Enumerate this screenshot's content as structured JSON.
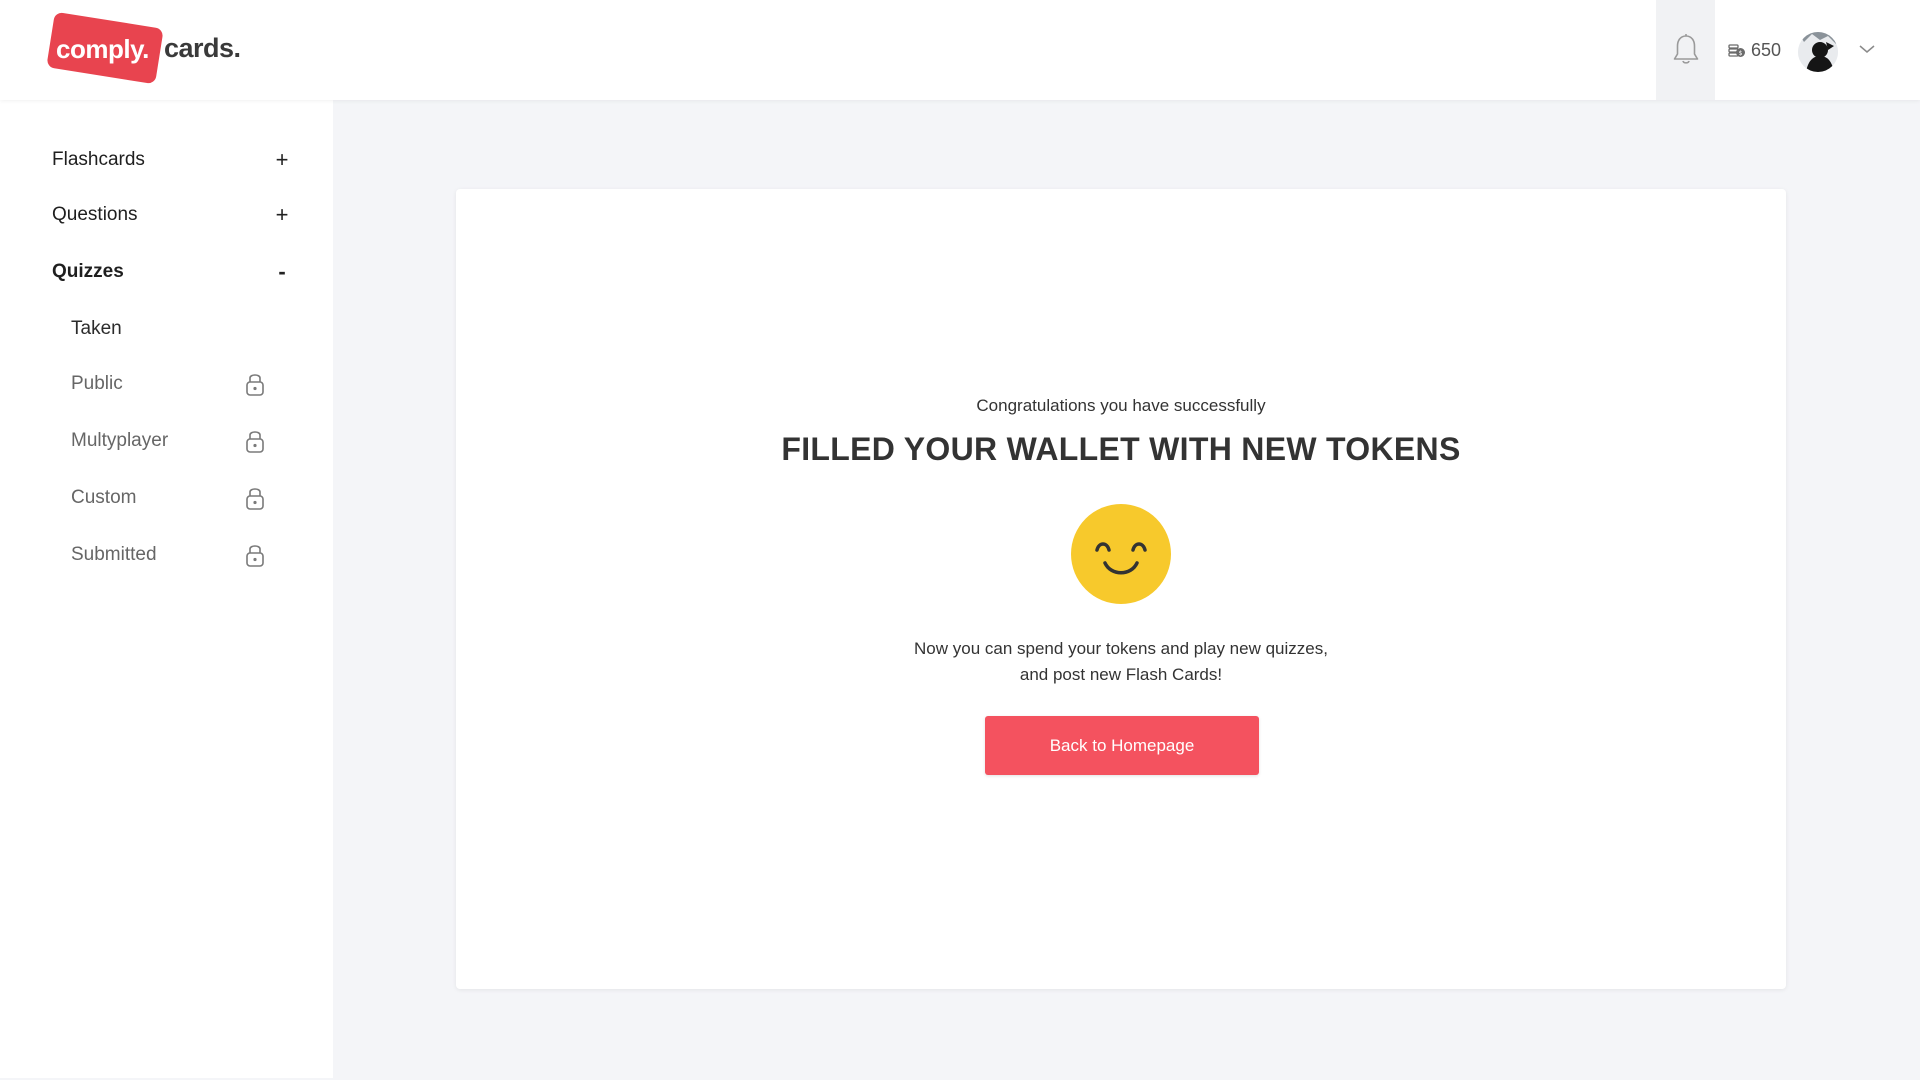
{
  "brand": {
    "word1": "comply.",
    "word2": "cards.",
    "accent_color": "#e8444f"
  },
  "header": {
    "bell_icon": "bell-icon",
    "wallet_icon": "coins-icon",
    "token_balance": "650",
    "avatar_icon": "user-avatar",
    "menu_icon": "chevron-down-icon"
  },
  "sidebar": {
    "sections": [
      {
        "label": "Flashcards",
        "toggle": "+"
      },
      {
        "label": "Questions",
        "toggle": "+"
      },
      {
        "label": "Quizzes",
        "toggle": "-"
      }
    ],
    "quiz_items": [
      {
        "label": "Taken",
        "locked": false
      },
      {
        "label": "Public",
        "locked": true
      },
      {
        "label": "Multyplayer",
        "locked": true
      },
      {
        "label": "Custom",
        "locked": true
      },
      {
        "label": "Submitted",
        "locked": true
      }
    ],
    "lock_icon": "lock-icon"
  },
  "main": {
    "subtitle": "Congratulations you have successfully",
    "title": "FILLED YOUR WALLET WITH NEW TOKENS",
    "emoji_icon": "smiley-face-icon",
    "message_line1": "Now you can spend your tokens and play new quizzes,",
    "message_line2": "and post new Flash Cards!",
    "button_label": "Back to Homepage",
    "button_color": "#f4525f",
    "emoji_color": "#f7c92c"
  }
}
